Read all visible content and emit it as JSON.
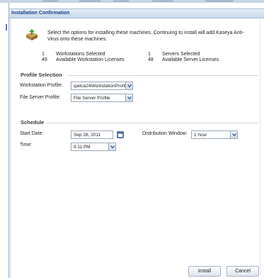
{
  "dialog": {
    "title": "Installation Confirmation",
    "intro": "Select the options for installing these machines. Continuing to install will add Kaseya Anti-Virus onto these machines."
  },
  "stats": {
    "workstations_selected_count": "1",
    "workstations_selected_label": "Workstations Selected",
    "workstation_licenses_count": "49",
    "workstation_licenses_label": "Available Workstation Licenses",
    "servers_selected_count": "1",
    "servers_selected_label": "Servers Selected",
    "server_licenses_count": "48",
    "server_licenses_label": "Available Server Licenses"
  },
  "profile_selection": {
    "title": "Profile Selection",
    "workstation_label": "Workstation Profile:",
    "workstation_value": "qaitca24WorkstationProfile",
    "server_label": "File Server Profile:",
    "server_value": "File Server Profile"
  },
  "schedule": {
    "title": "Schedule",
    "start_date_label": "Start Date:",
    "start_date_value": "Sep 28, 2011",
    "time_label": "Time:",
    "time_value": "8:11 PM",
    "window_label": "Distribution Window:",
    "window_value": "1 hour"
  },
  "buttons": {
    "install": "Install",
    "cancel": "Cancel"
  },
  "colors": {
    "title_text": "#15428b",
    "title_bar": "#c7d7ec",
    "border": "#99b1cf"
  }
}
